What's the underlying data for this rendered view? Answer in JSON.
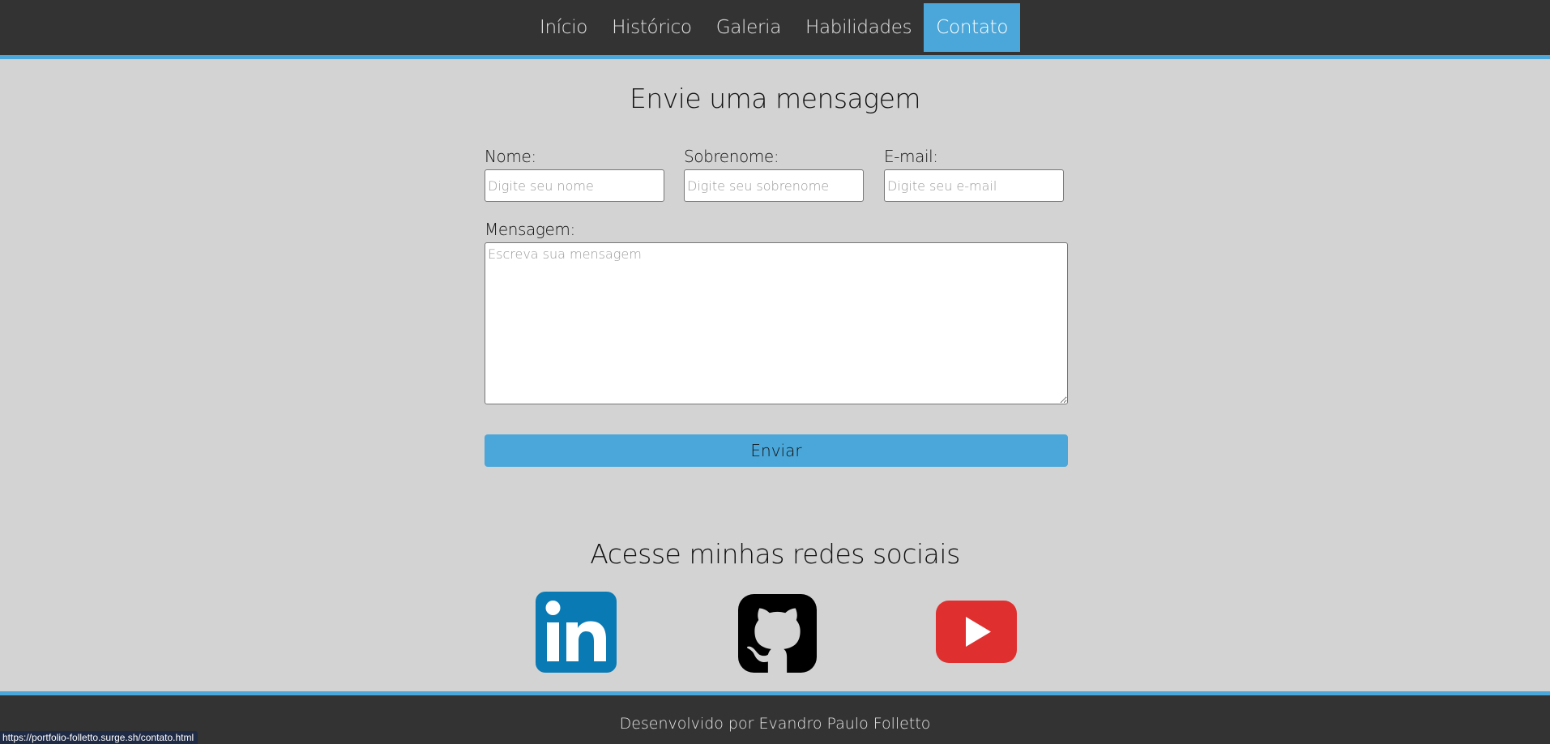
{
  "nav": {
    "items": [
      {
        "label": "Início"
      },
      {
        "label": "Histórico"
      },
      {
        "label": "Galeria"
      },
      {
        "label": "Habilidades"
      },
      {
        "label": "Contato",
        "active": true
      }
    ]
  },
  "form": {
    "title": "Envie uma mensagem",
    "name_label": "Nome:",
    "name_placeholder": "Digite seu nome",
    "surname_label": "Sobrenome:",
    "surname_placeholder": "Digite seu sobrenome",
    "email_label": "E-mail:",
    "email_placeholder": "Digite seu e-mail",
    "message_label": "Mensagem:",
    "message_placeholder": "Escreva sua mensagem",
    "submit_label": "Enviar"
  },
  "social": {
    "title": "Acesse minhas redes sociais",
    "links": [
      {
        "icon": "linkedin-icon"
      },
      {
        "icon": "github-icon"
      },
      {
        "icon": "youtube-icon"
      }
    ]
  },
  "footer": {
    "text": "Desenvolvido por Evandro Paulo Folletto"
  },
  "status_bar": {
    "url": "https://portfolio-folletto.surge.sh/contato.html"
  },
  "colors": {
    "accent": "#4ba7d9",
    "nav_bg": "#333333",
    "page_bg": "#d3d3d3",
    "linkedin": "#0a7ab5",
    "youtube": "#e02f2f"
  }
}
